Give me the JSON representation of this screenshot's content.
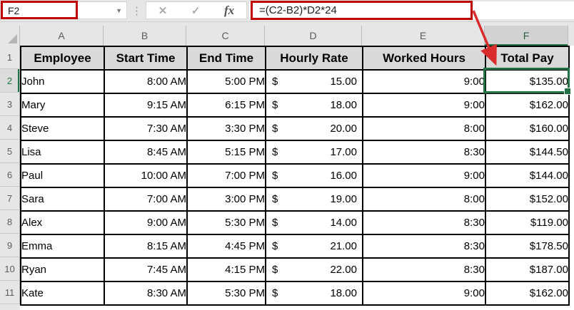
{
  "name_box": {
    "cell_reference": "F2"
  },
  "formula_bar": {
    "cancel_label": "✕",
    "enter_label": "✓",
    "fx_label": "fx",
    "formula": "=(C2-B2)*D2*24"
  },
  "sheet": {
    "column_letters": [
      "A",
      "B",
      "C",
      "D",
      "E",
      "F"
    ],
    "selected_column": "F",
    "row_numbers": [
      "1",
      "2",
      "3",
      "4",
      "5",
      "6",
      "7",
      "8",
      "9",
      "10",
      "11"
    ],
    "selected_row": "2",
    "selected_cell": "F2",
    "header_row": [
      "Employee",
      "Start Time",
      "End Time",
      "Hourly Rate",
      "Worked Hours",
      "Total Pay"
    ],
    "currency_symbol": "$",
    "rows": [
      {
        "employee": "John",
        "start_time": "8:00 AM",
        "end_time": "5:00 PM",
        "hourly_rate": "15.00",
        "worked_hours": "9:00",
        "total_pay": "$135.00"
      },
      {
        "employee": "Mary",
        "start_time": "9:15 AM",
        "end_time": "6:15 PM",
        "hourly_rate": "18.00",
        "worked_hours": "9:00",
        "total_pay": "$162.00"
      },
      {
        "employee": "Steve",
        "start_time": "7:30 AM",
        "end_time": "3:30 PM",
        "hourly_rate": "20.00",
        "worked_hours": "8:00",
        "total_pay": "$160.00"
      },
      {
        "employee": "Lisa",
        "start_time": "8:45 AM",
        "end_time": "5:15 PM",
        "hourly_rate": "17.00",
        "worked_hours": "8:30",
        "total_pay": "$144.50"
      },
      {
        "employee": "Paul",
        "start_time": "10:00 AM",
        "end_time": "7:00 PM",
        "hourly_rate": "16.00",
        "worked_hours": "9:00",
        "total_pay": "$144.00"
      },
      {
        "employee": "Sara",
        "start_time": "7:00 AM",
        "end_time": "3:00 PM",
        "hourly_rate": "19.00",
        "worked_hours": "8:00",
        "total_pay": "$152.00"
      },
      {
        "employee": "Alex",
        "start_time": "9:00 AM",
        "end_time": "5:30 PM",
        "hourly_rate": "14.00",
        "worked_hours": "8:30",
        "total_pay": "$119.00"
      },
      {
        "employee": "Emma",
        "start_time": "8:15 AM",
        "end_time": "4:45 PM",
        "hourly_rate": "21.00",
        "worked_hours": "8:30",
        "total_pay": "$178.50"
      },
      {
        "employee": "Ryan",
        "start_time": "7:45 AM",
        "end_time": "4:15 PM",
        "hourly_rate": "22.00",
        "worked_hours": "8:30",
        "total_pay": "$187.00"
      },
      {
        "employee": "Kate",
        "start_time": "8:30 AM",
        "end_time": "5:30 PM",
        "hourly_rate": "18.00",
        "worked_hours": "9:00",
        "total_pay": "$162.00"
      }
    ]
  },
  "colors": {
    "selection_green": "#217346",
    "annotation_red": "#C00000",
    "arrow_red": "#D92B2B",
    "header_row_fill": "#D9D9D9",
    "chrome_gray": "#E6E6E6"
  }
}
